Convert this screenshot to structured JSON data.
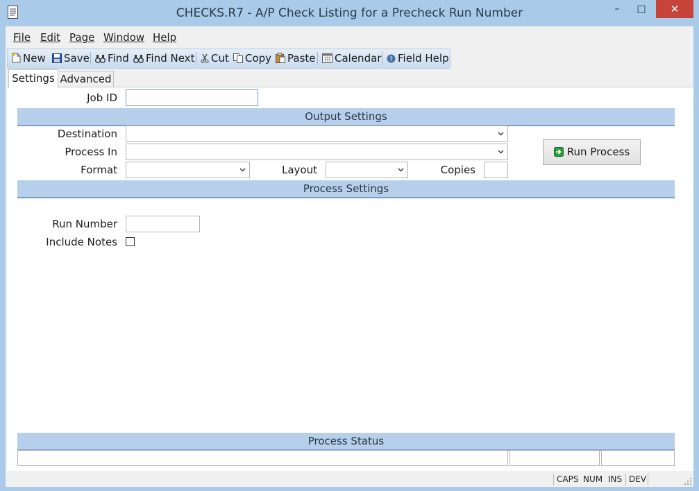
{
  "window": {
    "title": "CHECKS.R7 - A/P Check Listing for a Precheck Run Number",
    "minimize_glyph": "–",
    "maximize_glyph": "□",
    "close_glyph": "✕"
  },
  "menu": {
    "items": [
      {
        "label": "File"
      },
      {
        "label": "Edit"
      },
      {
        "label": "Page"
      },
      {
        "label": "Window"
      },
      {
        "label": "Help"
      }
    ]
  },
  "toolbar": {
    "new_label": "New",
    "save_label": "Save",
    "find_label": "Find",
    "find_next_label": "Find Next",
    "cut_label": "Cut",
    "copy_label": "Copy",
    "paste_label": "Paste",
    "calendar_label": "Calendar",
    "field_help_label": "Field Help"
  },
  "tabs": [
    {
      "label": "Settings",
      "active": true
    },
    {
      "label": "Advanced",
      "active": false
    }
  ],
  "form": {
    "job_id": {
      "label": "Job ID",
      "value": ""
    },
    "output_settings_title": "Output Settings",
    "destination": {
      "label": "Destination",
      "value": ""
    },
    "process_in": {
      "label": "Process In",
      "value": ""
    },
    "format": {
      "label": "Format",
      "value": ""
    },
    "layout": {
      "label": "Layout",
      "value": ""
    },
    "copies": {
      "label": "Copies",
      "value": ""
    },
    "run_process_label": "Run Process",
    "process_settings_title": "Process Settings",
    "run_number": {
      "label": "Run Number",
      "value": ""
    },
    "include_notes": {
      "label": "Include Notes",
      "checked": false
    }
  },
  "process_status": {
    "title": "Process Status",
    "cells": [
      "",
      "",
      ""
    ]
  },
  "statusbar": {
    "indicators": [
      "CAPS",
      "NUM",
      "INS",
      "DEV"
    ]
  },
  "colors": {
    "chrome": "#a9cbe9",
    "section_header": "#b6cfea",
    "close_button": "#c7443a"
  }
}
